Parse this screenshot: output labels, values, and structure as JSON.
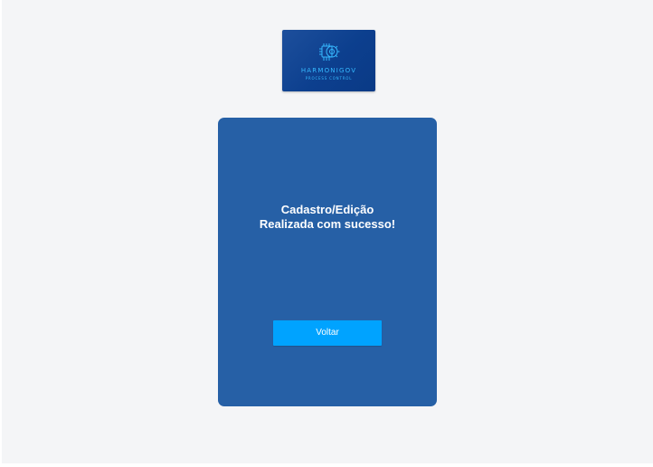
{
  "logo": {
    "icon": "gear-chip-icon",
    "title": "HARMONIGOV",
    "subtitle": "PROCESS CONTROL"
  },
  "card": {
    "message_line1": "Cadastro/Edição",
    "message_line2": "Realizada com sucesso!",
    "button_label": "Voltar"
  },
  "colors": {
    "background": "#f4f5f7",
    "card": "#2660a6",
    "button": "#00a3ff",
    "logo_accent": "#36b9ff"
  }
}
